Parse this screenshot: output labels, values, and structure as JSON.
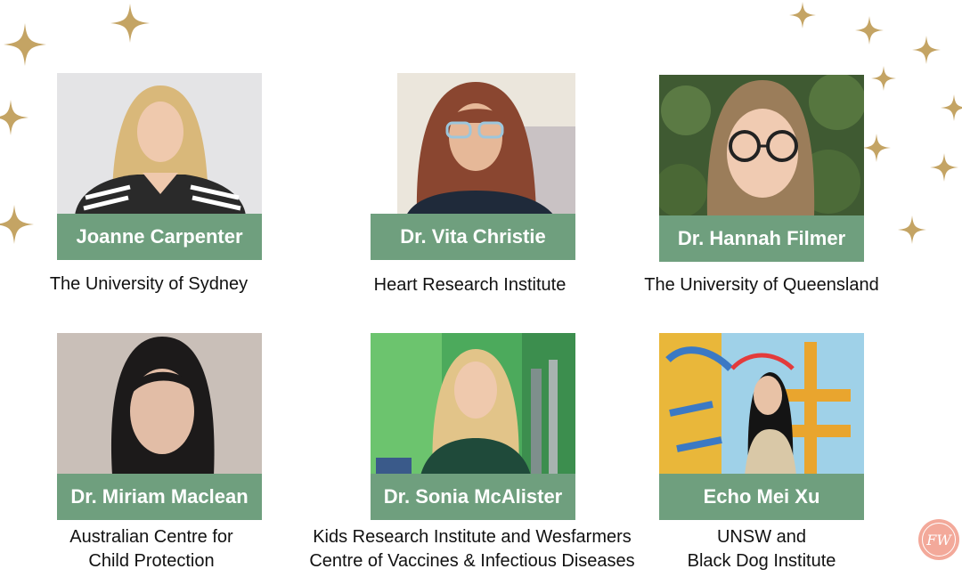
{
  "colors": {
    "accent_green": "#6f9f7e",
    "star_gold": "#c4a464",
    "logo_pink": "#f3a99a"
  },
  "decor": {
    "star_icon": "sparkle-star-icon"
  },
  "logo": {
    "text": "FW"
  },
  "people": [
    {
      "name": "Joanne Carpenter",
      "affiliation": [
        "The University of Sydney"
      ]
    },
    {
      "name": "Dr. Vita Christie",
      "affiliation": [
        "Heart Research Institute"
      ]
    },
    {
      "name": "Dr. Hannah Filmer",
      "affiliation": [
        "The University of Queensland"
      ]
    },
    {
      "name": "Dr. Miriam Maclean",
      "affiliation": [
        "Australian Centre for",
        "Child Protection"
      ]
    },
    {
      "name": "Dr. Sonia McAlister",
      "affiliation": [
        "Kids Research Institute and Wesfarmers",
        "Centre of Vaccines & Infectious Diseases"
      ]
    },
    {
      "name": "Echo Mei Xu",
      "affiliation": [
        "UNSW and",
        "Black Dog Institute"
      ]
    }
  ]
}
